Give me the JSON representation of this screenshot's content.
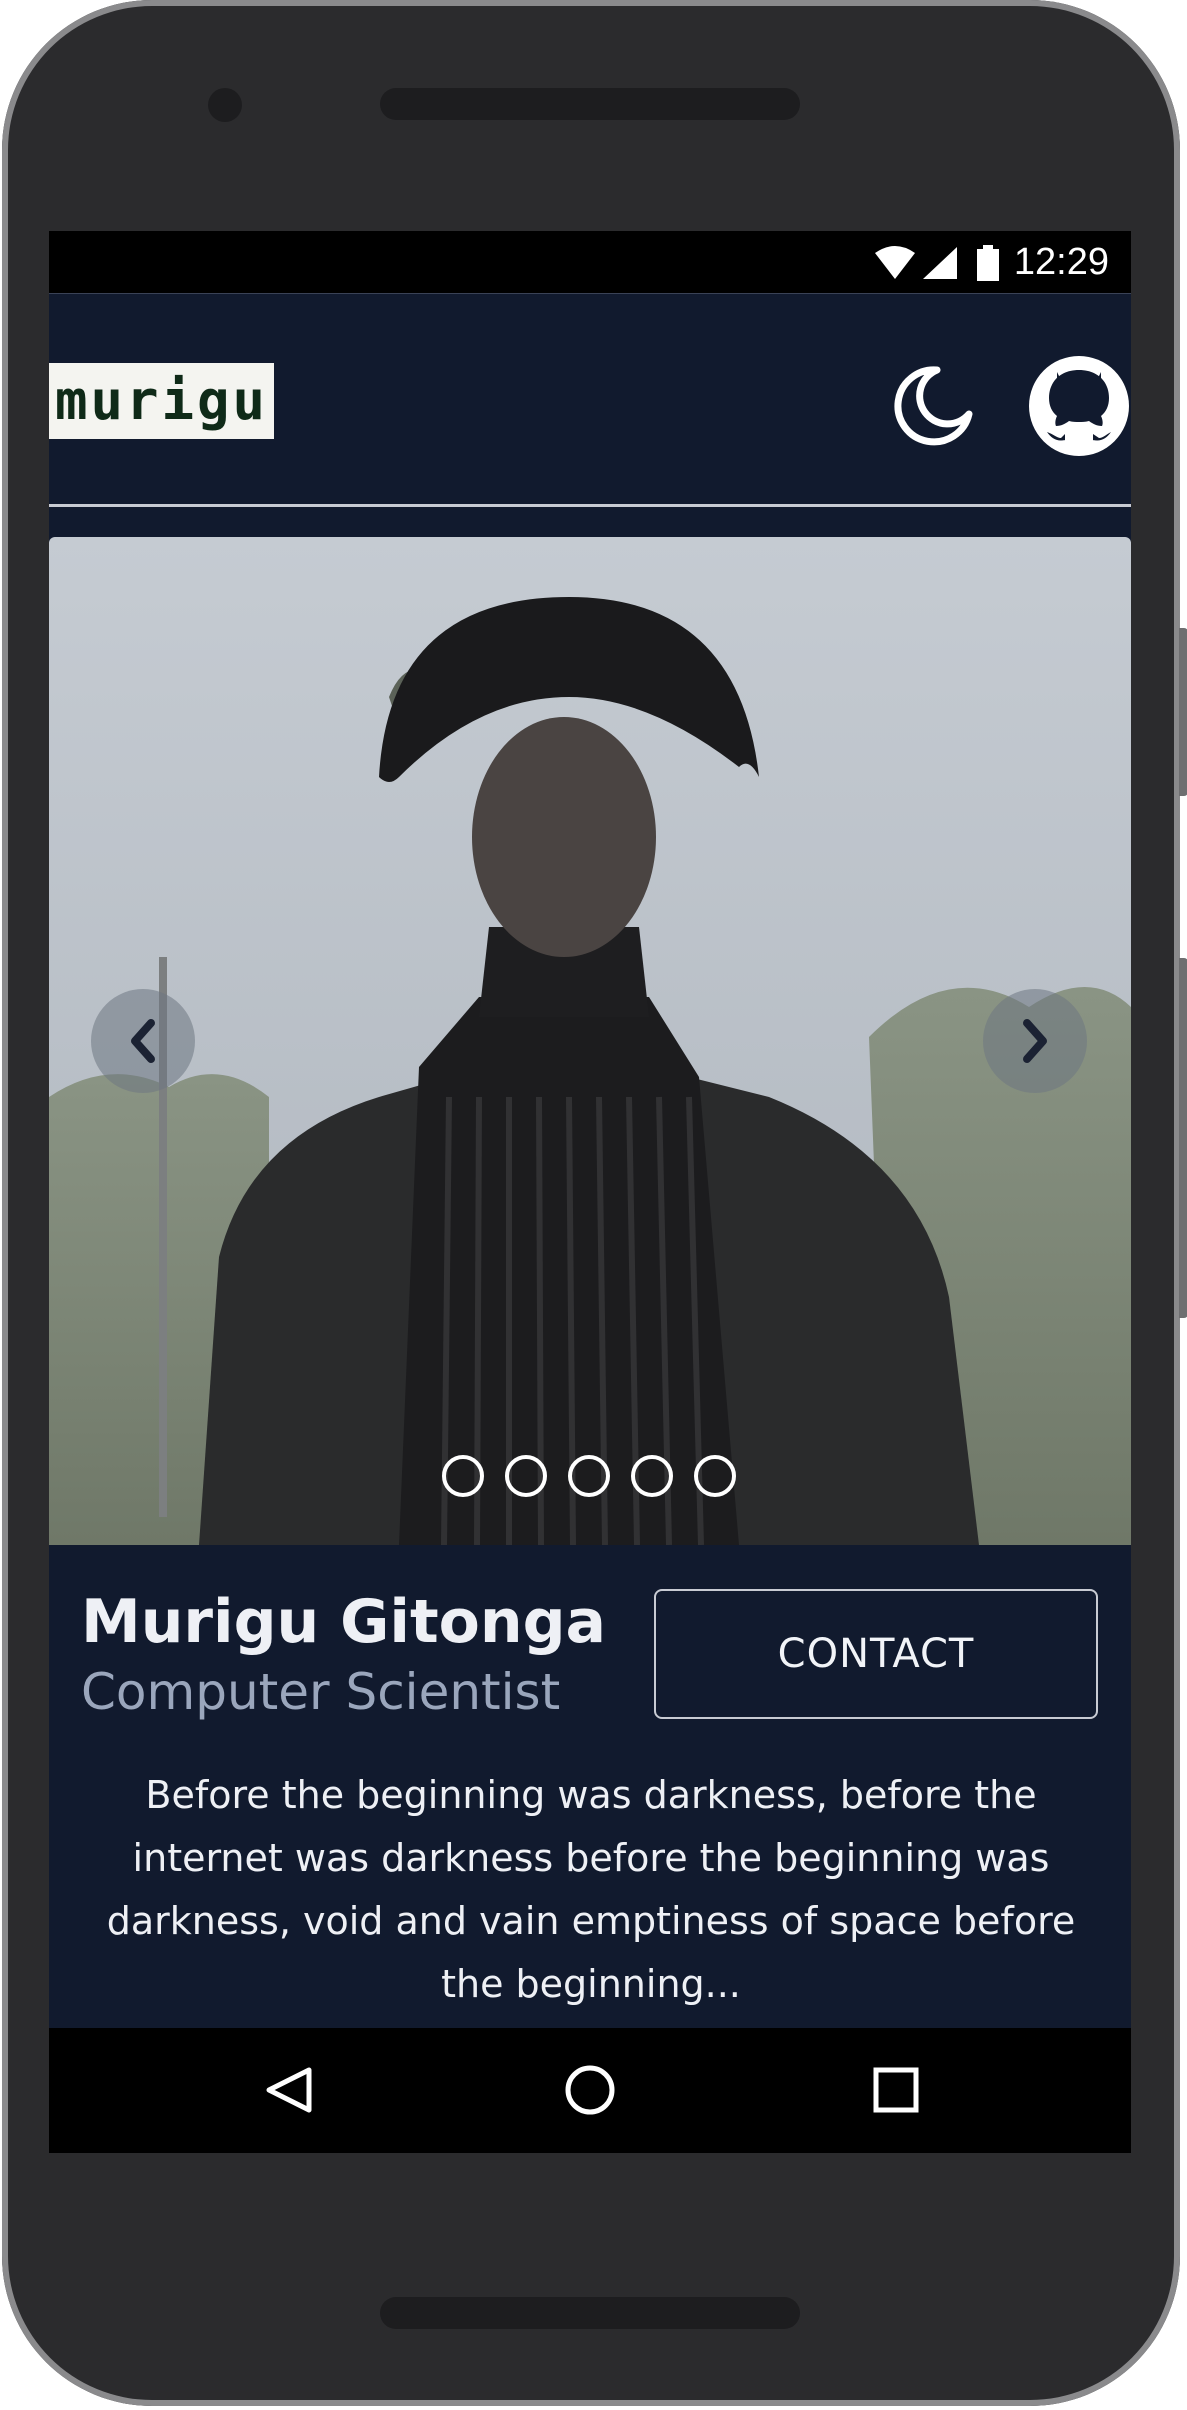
{
  "status_bar": {
    "time": "12:29",
    "icons": [
      "wifi-icon",
      "signal-icon",
      "battery-icon"
    ]
  },
  "header": {
    "logo_text": "murigu",
    "icons": [
      "moon-icon",
      "github-icon"
    ]
  },
  "carousel": {
    "photo_description_icon": "portrait-photo",
    "prev_icon": "chevron-left-icon",
    "next_icon": "chevron-right-icon",
    "slide_count": 5
  },
  "profile": {
    "name": "Murigu Gitonga",
    "role": "Computer Scientist",
    "contact_label": "CONTACT",
    "bio": "Before the beginning was darkness, before the internet was darkness before the beginning was darkness, void and vain emptiness of space before the beginning..."
  },
  "android_nav": {
    "icons": [
      "back-icon",
      "home-icon",
      "recents-icon"
    ]
  },
  "colors": {
    "background": "#111a2e",
    "text": "#eef0f5",
    "muted": "#9aa6bc"
  }
}
